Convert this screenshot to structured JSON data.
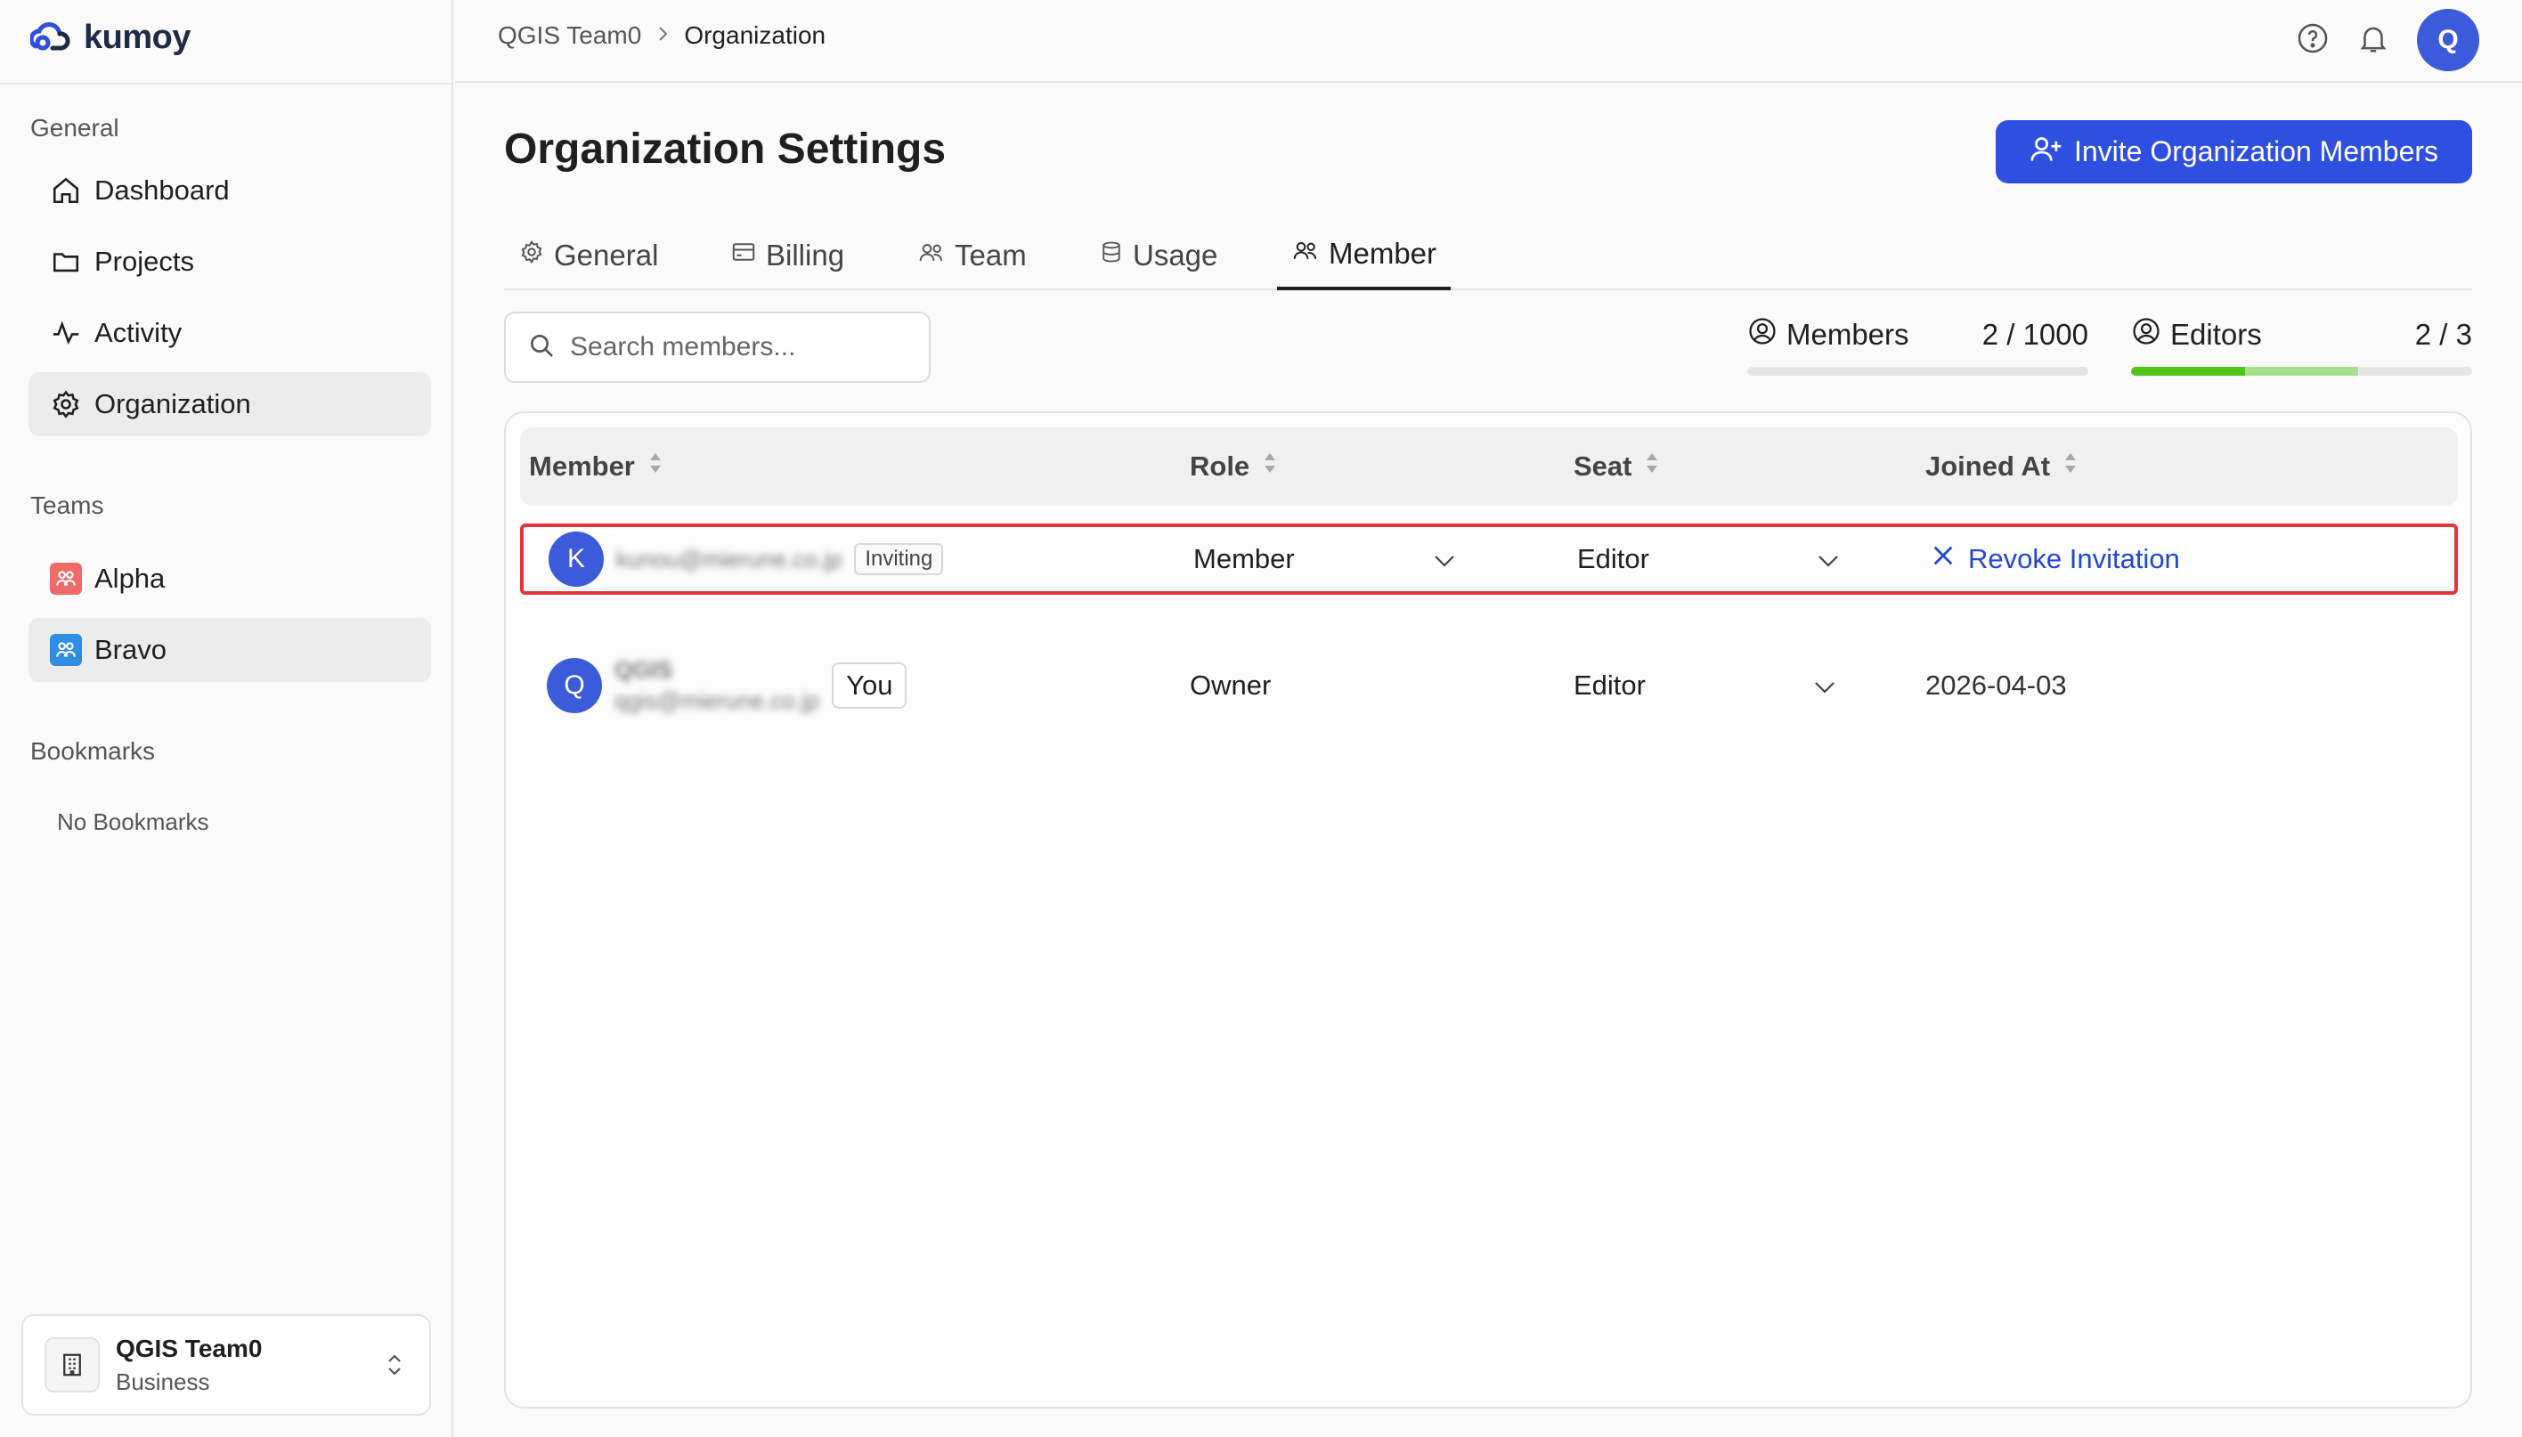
{
  "app": {
    "brand": "kumoy"
  },
  "sidebar": {
    "general_label": "General",
    "nav": [
      {
        "label": "Dashboard",
        "icon": "home-icon"
      },
      {
        "label": "Projects",
        "icon": "folder-icon"
      },
      {
        "label": "Activity",
        "icon": "activity-icon"
      },
      {
        "label": "Organization",
        "icon": "gear-icon"
      }
    ],
    "teams_label": "Teams",
    "teams": [
      {
        "label": "Alpha",
        "color": "#f06a6a"
      },
      {
        "label": "Bravo",
        "color": "#2f8de4"
      }
    ],
    "bookmarks_label": "Bookmarks",
    "no_bookmarks": "No Bookmarks",
    "org_switcher": {
      "name": "QGIS Team0",
      "plan": "Business"
    }
  },
  "topbar": {
    "breadcrumb": [
      "QGIS Team0",
      "Organization"
    ],
    "avatar_initial": "Q"
  },
  "page": {
    "title": "Organization Settings",
    "invite_button": "Invite Organization Members"
  },
  "tabs": [
    {
      "label": "General",
      "icon": "gear-icon"
    },
    {
      "label": "Billing",
      "icon": "credit-card-icon"
    },
    {
      "label": "Team",
      "icon": "users-icon"
    },
    {
      "label": "Usage",
      "icon": "database-icon"
    },
    {
      "label": "Member",
      "icon": "users-icon",
      "active": true
    }
  ],
  "search": {
    "placeholder": "Search members...",
    "value": ""
  },
  "stats": {
    "members": {
      "label": "Members",
      "value": "2 / 1000"
    },
    "editors": {
      "label": "Editors",
      "value": "2 / 3",
      "used_fraction": 0.333,
      "pending_fraction": 0.333
    }
  },
  "table": {
    "columns": [
      "Member",
      "Role",
      "Seat",
      "Joined At"
    ],
    "rows": [
      {
        "initial": "K",
        "email": "kunou@mierune.co.jp",
        "status_badge": "Inviting",
        "role": "Member",
        "seat": "Editor",
        "action": "Revoke Invitation"
      },
      {
        "initial": "Q",
        "name": "QGIS",
        "email": "qgis@mierune.co.jp",
        "you_badge": "You",
        "role": "Owner",
        "seat": "Editor",
        "joined_at": "2026-04-03"
      }
    ]
  },
  "colors": {
    "accent": "#2f4fe0",
    "highlight": "#e5343c",
    "progress_used": "#52c41a",
    "progress_pending": "#a6e08a"
  }
}
